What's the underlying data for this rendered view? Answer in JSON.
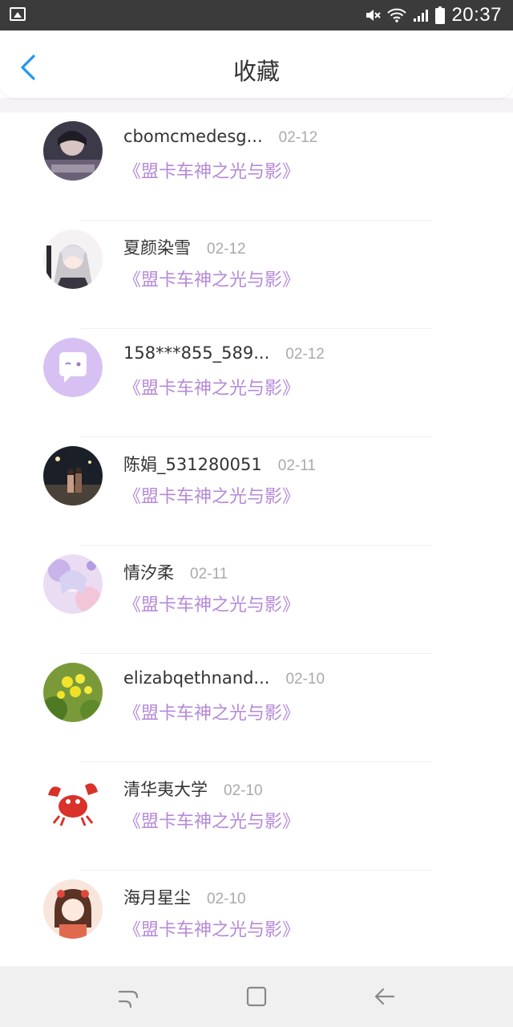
{
  "status_bar": {
    "time": "20:37"
  },
  "header": {
    "title": "收藏"
  },
  "items": [
    {
      "name": "cbomcmedesg...",
      "date": "02-12",
      "work": "《盟卡车神之光与影》"
    },
    {
      "name": "夏颜染雪",
      "date": "02-12",
      "work": "《盟卡车神之光与影》"
    },
    {
      "name": "158***855_589...",
      "date": "02-12",
      "work": "《盟卡车神之光与影》"
    },
    {
      "name": "陈娟_531280051",
      "date": "02-11",
      "work": "《盟卡车神之光与影》"
    },
    {
      "name": "情汐柔",
      "date": "02-11",
      "work": "《盟卡车神之光与影》"
    },
    {
      "name": "elizabqethnand...",
      "date": "02-10",
      "work": "《盟卡车神之光与影》"
    },
    {
      "name": "清华夷大学",
      "date": "02-10",
      "work": "《盟卡车神之光与影》"
    },
    {
      "name": "海月星尘",
      "date": "02-10",
      "work": "《盟卡车神之光与影》"
    }
  ],
  "colors": {
    "accent": "#2196f3",
    "work_title": "#b58ad8",
    "status_bar": "#3b3b3b"
  },
  "icons": {
    "back": "chevron-left-icon",
    "nav_recent": "recent-apps-icon",
    "nav_home": "home-icon",
    "nav_back": "back-arrow-icon"
  }
}
